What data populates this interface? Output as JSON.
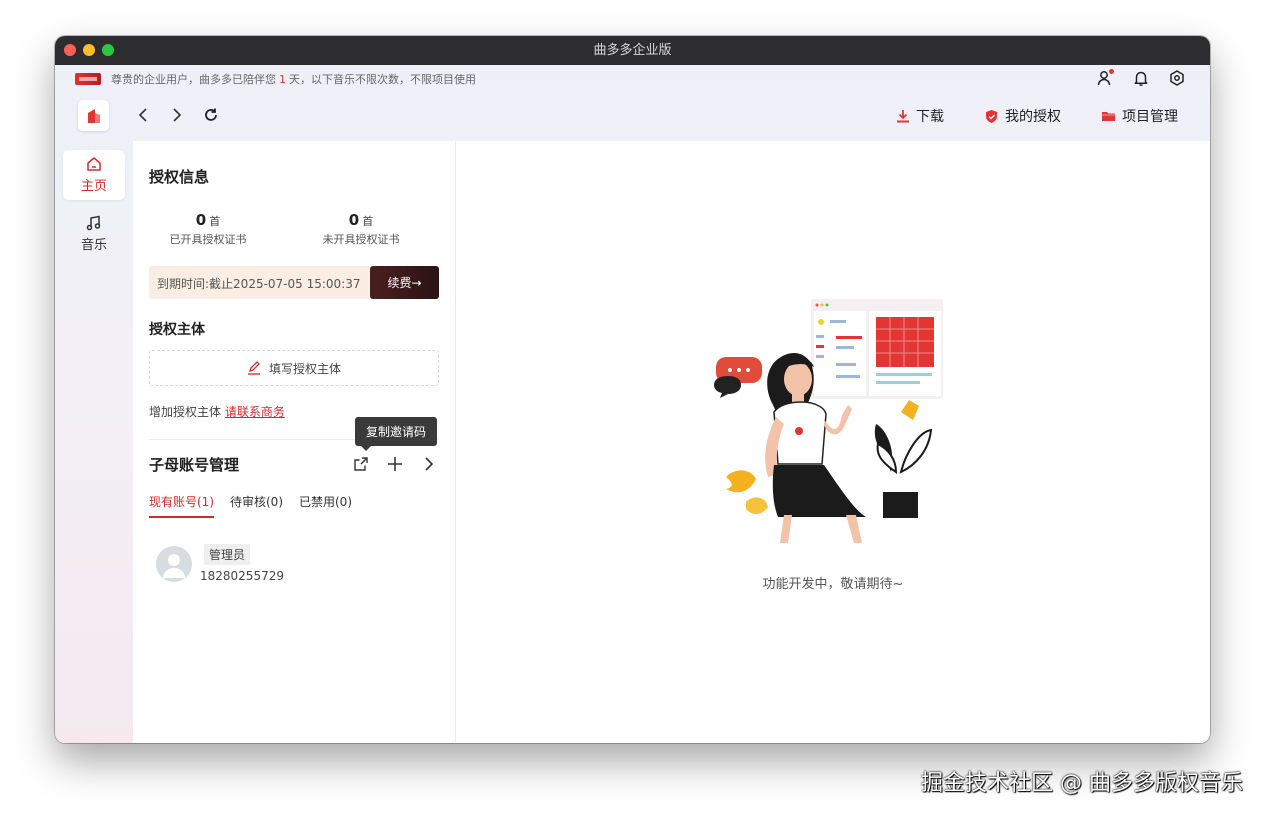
{
  "window": {
    "title": "曲多多企业版"
  },
  "notice": {
    "prefix": "尊贵的企业用户，曲多多已陪伴您",
    "days": "1",
    "suffix": "天，以下音乐不限次数，不限项目使用"
  },
  "topmenu": {
    "download": "下载",
    "my_auth": "我的授权",
    "project_manage": "项目管理"
  },
  "sidenav": {
    "home": "主页",
    "music": "音乐"
  },
  "auth_info": {
    "title": "授权信息",
    "issued_count": "0",
    "issued_unit": "首",
    "issued_label": "已开具授权证书",
    "not_issued_count": "0",
    "not_issued_unit": "首",
    "not_issued_label": "未开具授权证书",
    "expiry": "到期时间:截止2025-07-05 15:00:37",
    "renew_label": "续费→"
  },
  "auth_subject": {
    "title": "授权主体",
    "fill_label": "填写授权主体",
    "add_text": "增加授权主体",
    "contact_link": "请联系商务"
  },
  "sub_accounts": {
    "title": "子母账号管理",
    "tooltip": "复制邀请码",
    "tabs": [
      "现有账号(1)",
      "待审核(0)",
      "已禁用(0)"
    ],
    "account_role": "管理员",
    "account_phone": "18280255729"
  },
  "main": {
    "dev_text": "功能开发中，敬请期待~"
  },
  "watermark": "掘金技术社区 @ 曲多多版权音乐",
  "colors": {
    "accent": "#d42a2a",
    "titlebar": "#2d2d2f",
    "renew_bg": "#3a1a1a",
    "expiry_bg": "#faeee4"
  },
  "icons": {
    "top_right": [
      "user-icon",
      "bell-icon",
      "settings-icon"
    ],
    "sub_account_actions": [
      "share-icon",
      "plus-icon",
      "chevron-right-icon"
    ]
  }
}
